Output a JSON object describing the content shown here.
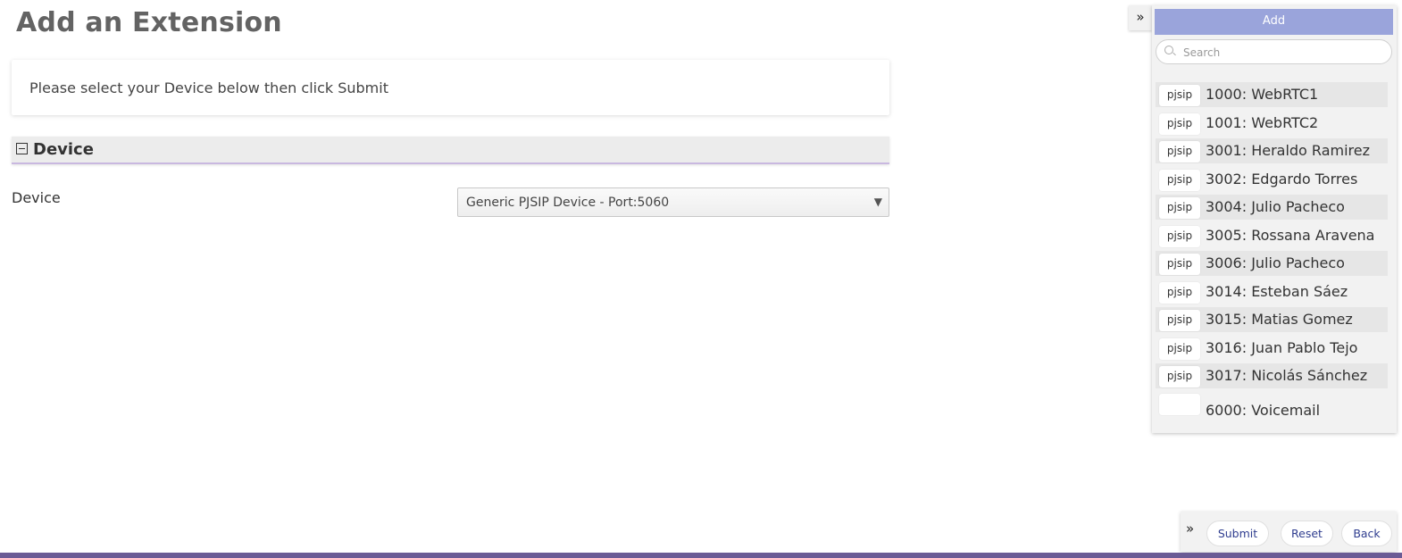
{
  "page": {
    "title": "Add an Extension"
  },
  "info": {
    "text": "Please select your Device below then click Submit"
  },
  "section": {
    "title": "Device"
  },
  "device": {
    "label": "Device",
    "selected": "Generic PJSIP Device - Port:5060"
  },
  "sidebar": {
    "toggle_glyph": "»",
    "add_label": "Add",
    "search_placeholder": "Search",
    "extensions": [
      {
        "tech": "pjsip",
        "label": "1000: WebRTC1"
      },
      {
        "tech": "pjsip",
        "label": "1001: WebRTC2"
      },
      {
        "tech": "pjsip",
        "label": "3001: Heraldo Ramirez"
      },
      {
        "tech": "pjsip",
        "label": "3002: Edgardo Torres"
      },
      {
        "tech": "pjsip",
        "label": "3004: Julio Pacheco"
      },
      {
        "tech": "pjsip",
        "label": "3005: Rossana Aravena"
      },
      {
        "tech": "pjsip",
        "label": "3006: Julio Pacheco"
      },
      {
        "tech": "pjsip",
        "label": "3014: Esteban Sáez"
      },
      {
        "tech": "pjsip",
        "label": "3015: Matias Gomez"
      },
      {
        "tech": "pjsip",
        "label": "3016: Juan Pablo Tejo"
      },
      {
        "tech": "pjsip",
        "label": "3017: Nicolás Sánchez"
      },
      {
        "tech": "",
        "label": "6000: Voicemail"
      }
    ]
  },
  "actions": {
    "toggle_glyph": "»",
    "submit": "Submit",
    "reset": "Reset",
    "back": "Back"
  },
  "colors": {
    "accent": "#9aa4db",
    "footer": "#6b5b95",
    "section_underline": "#c9b8e0"
  }
}
